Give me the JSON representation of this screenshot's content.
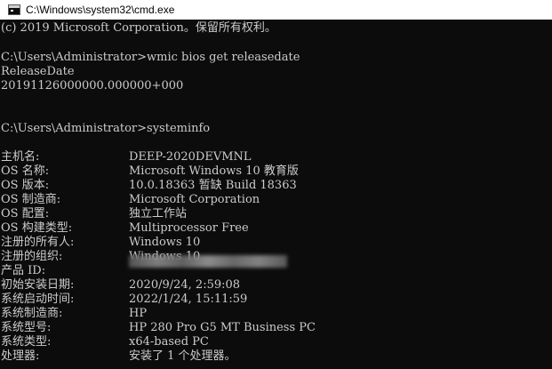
{
  "window": {
    "title": "C:\\Windows\\system32\\cmd.exe",
    "icon": "cmd-icon"
  },
  "console": {
    "lines": [
      "(c) 2019 Microsoft Corporation。保留所有权利。",
      "",
      "C:\\Users\\Administrator>wmic bios get releasedate",
      "ReleaseDate",
      "20191126000000.000000+000",
      "",
      "",
      "C:\\Users\\Administrator>systeminfo",
      ""
    ],
    "systeminfo": [
      {
        "key": "主机名:",
        "value": "DEEP-2020DEVMNL"
      },
      {
        "key": "OS 名称:",
        "value": "Microsoft Windows 10 教育版"
      },
      {
        "key": "OS 版本:",
        "value": "10.0.18363 暂缺 Build 18363"
      },
      {
        "key": "OS 制造商:",
        "value": "Microsoft Corporation"
      },
      {
        "key": "OS 配置:",
        "value": "独立工作站"
      },
      {
        "key": "OS 构建类型:",
        "value": "Multiprocessor Free"
      },
      {
        "key": "注册的所有人:",
        "value": "Windows 10"
      },
      {
        "key": "注册的组织:",
        "value": "Windows 10"
      },
      {
        "key": "产品 ID:",
        "value": ""
      },
      {
        "key": "初始安装日期:",
        "value": "2020/9/24, 2:59:08"
      },
      {
        "key": "系统启动时间:",
        "value": "2022/1/24, 15:11:59"
      },
      {
        "key": "系统制造商:",
        "value": "HP"
      },
      {
        "key": "系统型号:",
        "value": "HP 280 Pro G5 MT Business PC"
      },
      {
        "key": "系统类型:",
        "value": "x64-based PC"
      },
      {
        "key": "处理器:",
        "value": "安装了 1 个处理器。"
      }
    ]
  },
  "colors": {
    "background": "#0c0c0c",
    "text": "#cccccc",
    "titlebar": "#ffffff"
  }
}
